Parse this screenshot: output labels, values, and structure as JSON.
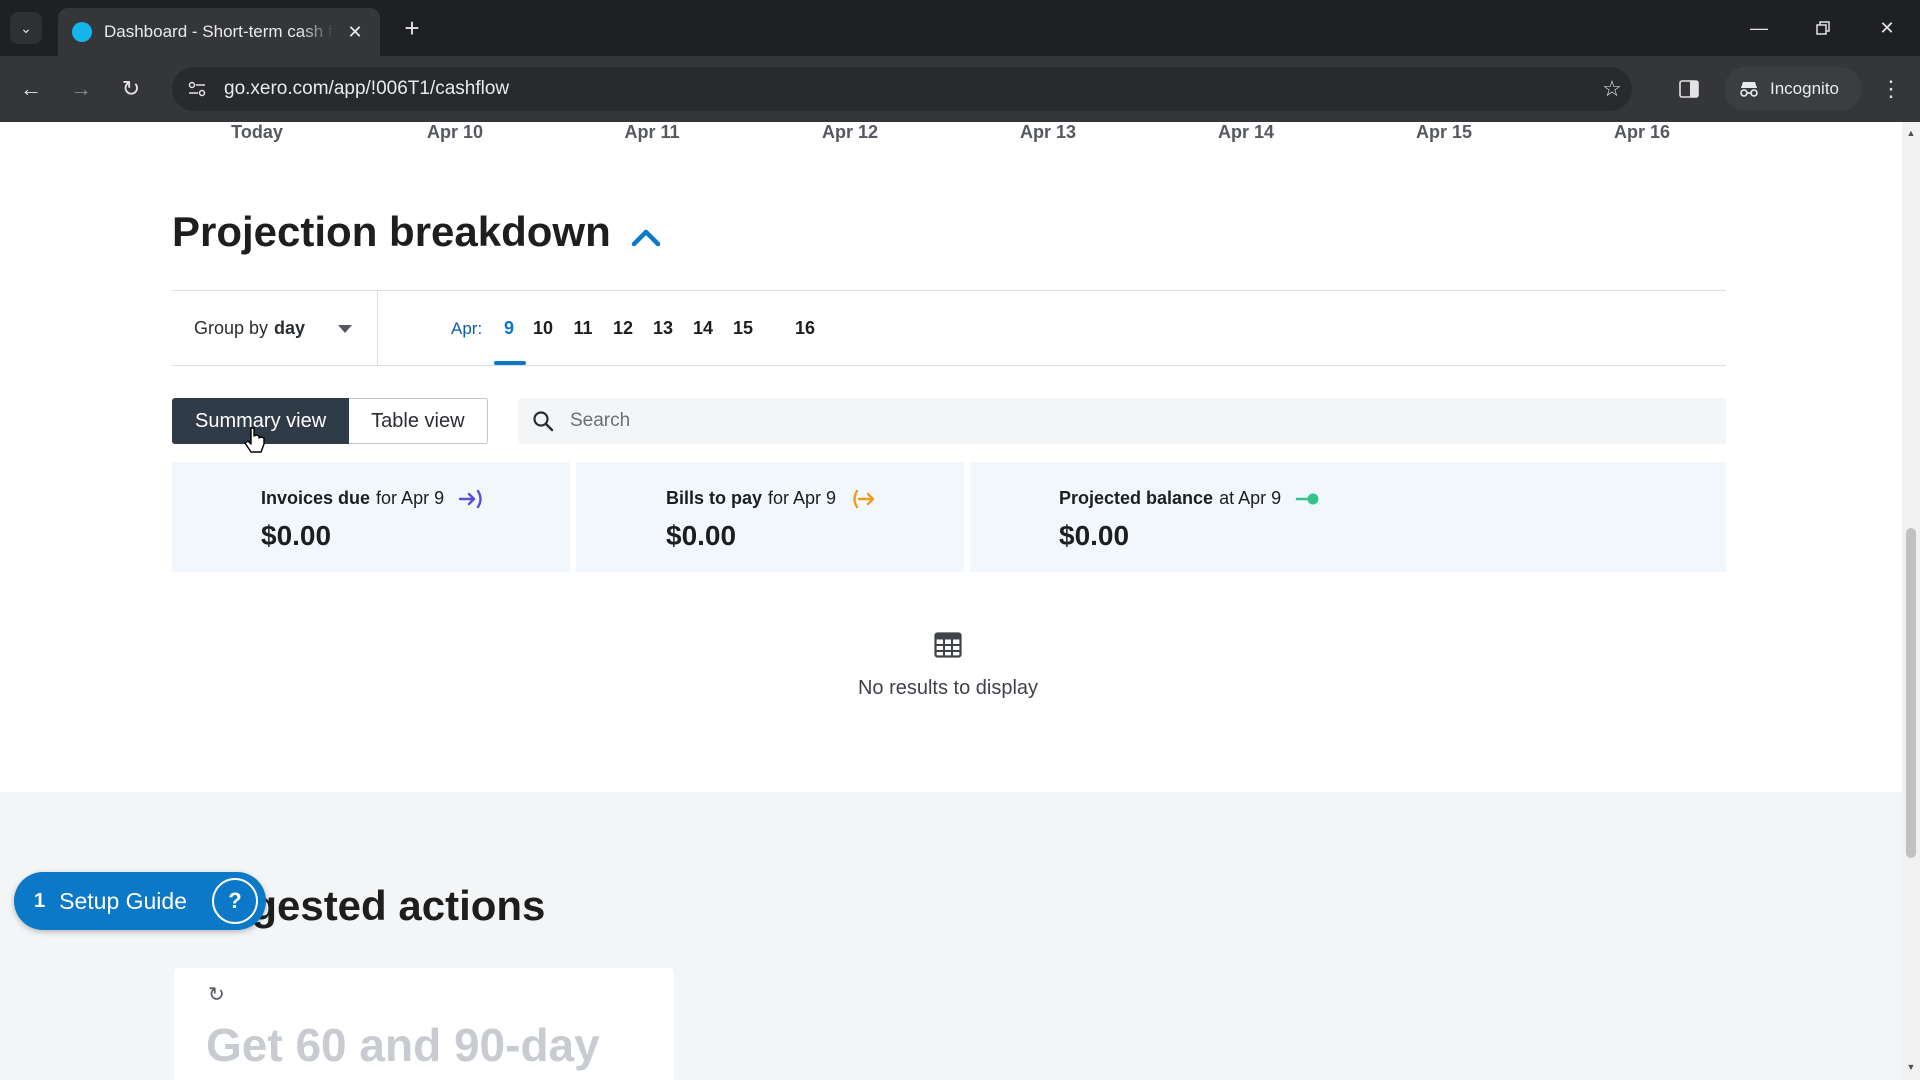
{
  "browser": {
    "tab_title": "Dashboard - Short-term cash flow",
    "url": "go.xero.com/app/!006T1/cashflow",
    "profile_label": "Incognito",
    "icons": {
      "tab_list": "chevron-down-icon",
      "tab_close": "close-icon",
      "new_tab": "plus-icon",
      "minimize": "minimize-icon",
      "restore": "restore-icon",
      "close_window": "close-icon",
      "back": "arrow-left-icon",
      "forward": "arrow-right-icon",
      "reload": "reload-icon",
      "site_info": "tune-icon",
      "bookmark": "star-icon",
      "side_panel": "side-panel-icon",
      "incognito": "incognito-icon",
      "menu": "more-vert-icon"
    }
  },
  "chart_axis": {
    "dates": [
      "Today",
      "Apr 10",
      "Apr 11",
      "Apr 12",
      "Apr 13",
      "Apr 14",
      "Apr 15",
      "Apr 16"
    ]
  },
  "projection": {
    "title": "Projection breakdown",
    "group_by_prefix": "Group by",
    "group_by_value": "day",
    "month_label": "Apr:",
    "days": [
      "9",
      "10",
      "11",
      "12",
      "13",
      "14",
      "15",
      "16"
    ],
    "selected_day": "9",
    "summary_view_label": "Summary view",
    "table_view_label": "Table view",
    "search_placeholder": "Search",
    "cards": [
      {
        "label_bold": "Invoices due",
        "label_rest": "for Apr 9",
        "value": "$0.00",
        "icon": "arrow-in-icon",
        "color": "#5b4fd6"
      },
      {
        "label_bold": "Bills to pay",
        "label_rest": "for Apr 9",
        "value": "$0.00",
        "icon": "arrow-out-icon",
        "color": "#f29a1f"
      },
      {
        "label_bold": "Projected balance",
        "label_rest": "at Apr 9",
        "value": "$0.00",
        "icon": "balance-dot-icon",
        "color": "#34c48b"
      }
    ],
    "empty_text": "No results to display"
  },
  "suggested": {
    "title": "Suggested actions",
    "card_text": "Get 60 and 90-day"
  },
  "setup_guide": {
    "count": "1",
    "label": "Setup Guide"
  },
  "colors": {
    "accent": "#0b78c8",
    "active_toggle": "#2f3b46",
    "card_bg": "#f2f7fc"
  }
}
